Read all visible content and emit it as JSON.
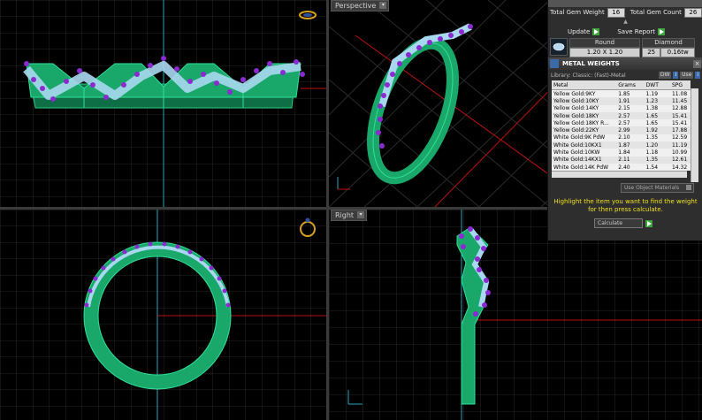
{
  "viewports": {
    "perspective_label": "Perspective",
    "right_label": "Right"
  },
  "panel": {
    "total_gem_weight_label": "Total Gem Weight",
    "total_gem_weight_value": "16",
    "total_gem_count_label": "Total Gem Count",
    "total_gem_count_value": "26",
    "update_label": "Update",
    "save_report_label": "Save Report",
    "gem": {
      "round_label": "Round",
      "size_value": "1.20 X 1.20",
      "diamond_label": "Diamond",
      "count_value": "25",
      "weight_value": "0.16tw"
    }
  },
  "metal_weights": {
    "title": "METAL WEIGHTS",
    "library_label": "Library: Classic: (Fast)-Metal",
    "btn_dw": "DW",
    "btn_use": "Use",
    "columns": [
      "Metal",
      "Grams",
      "DWT",
      "SPG"
    ],
    "rows": [
      [
        "Yellow Gold:9KY",
        "1.85",
        "1.19",
        "11.08"
      ],
      [
        "Yellow Gold:10KY",
        "1.91",
        "1.23",
        "11.45"
      ],
      [
        "Yellow Gold:14KY",
        "2.15",
        "1.38",
        "12.88"
      ],
      [
        "Yellow Gold:18KY",
        "2.57",
        "1.65",
        "15.41"
      ],
      [
        "Yellow Gold:18KY R...",
        "2.57",
        "1.65",
        "15.41"
      ],
      [
        "Yellow Gold:22KY",
        "2.99",
        "1.92",
        "17.88"
      ],
      [
        "White Gold:9K PdW",
        "2.10",
        "1.35",
        "12.59"
      ],
      [
        "White Gold:10KX1",
        "1.87",
        "1.20",
        "11.19"
      ],
      [
        "White Gold:10KW",
        "1.84",
        "1.18",
        "10.99"
      ],
      [
        "White Gold:14KX1",
        "2.11",
        "1.35",
        "12.61"
      ],
      [
        "White Gold:14K PdW",
        "2.40",
        "1.54",
        "14.32"
      ]
    ],
    "use_object_materials": "Use Object Materials",
    "hint": "Highlight the item you want to find the weight for then press calculate.",
    "calculate_label": "Calculate"
  },
  "colors": {
    "background": "#000000",
    "grid_minor": "#1e1e1e",
    "grid_major": "#3a3a3a",
    "axis_red": "#c01010",
    "axis_cyan": "#2aa6b8",
    "metal": "#1aa86a",
    "metal_dark": "#0c5a3a",
    "gem": "#a8d8f0",
    "prong": "#7a2ab0",
    "hint_yellow": "#f0e020"
  }
}
